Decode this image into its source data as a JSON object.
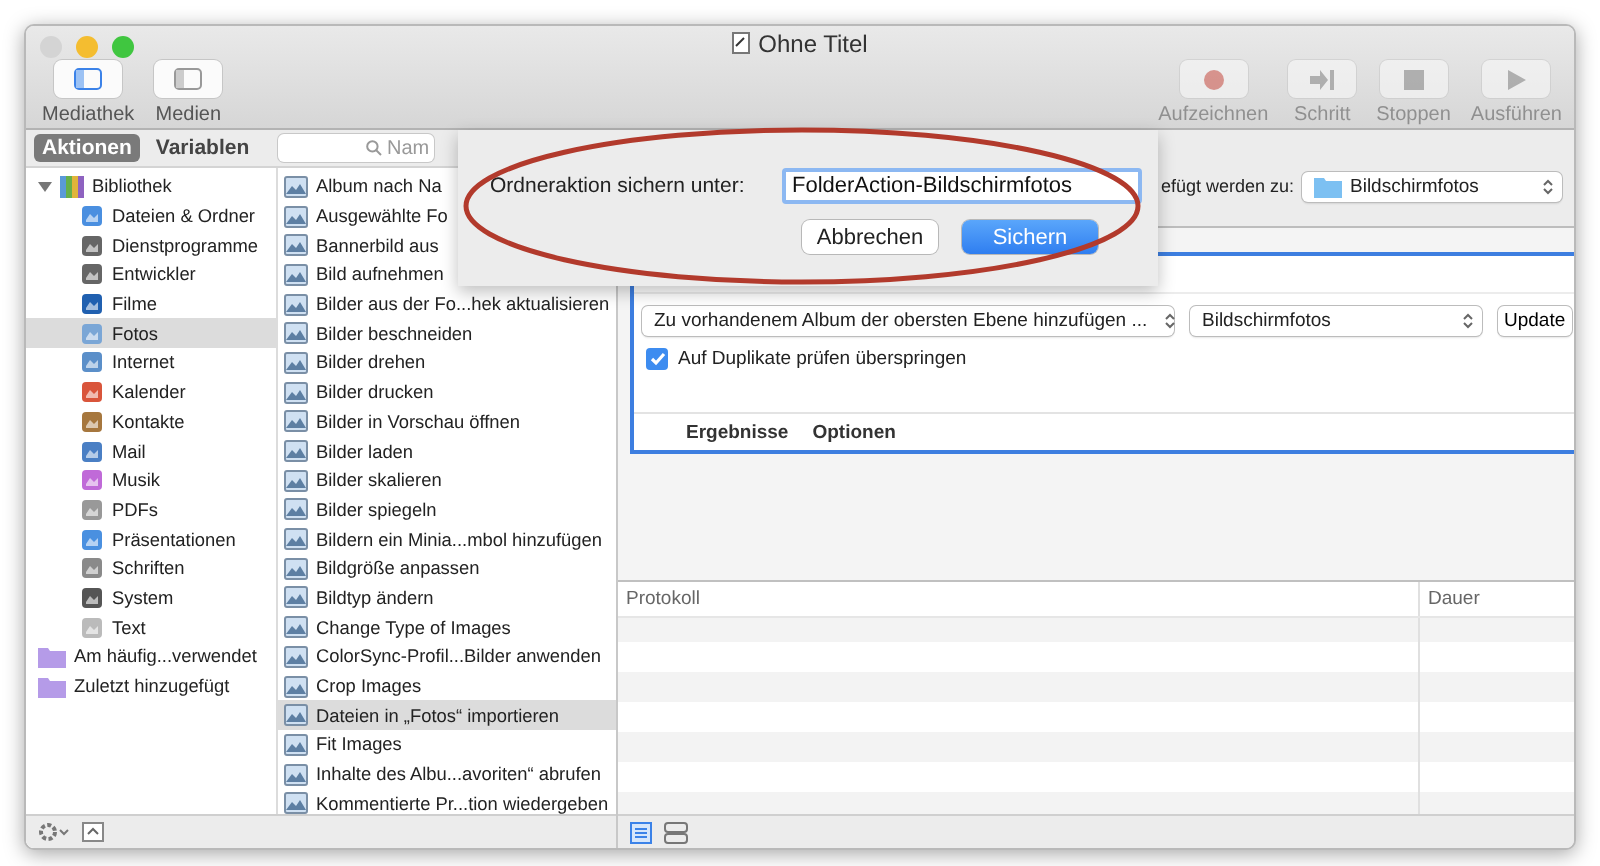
{
  "window": {
    "title": "Ohne Titel"
  },
  "toolbar_left": [
    {
      "label": "Mediathek",
      "selected": true
    },
    {
      "label": "Medien",
      "selected": false
    }
  ],
  "toolbar_right": [
    {
      "label": "Aufzeichnen",
      "kind": "record",
      "disabled": true
    },
    {
      "label": "Schritt",
      "kind": "step",
      "disabled": true
    },
    {
      "label": "Stoppen",
      "kind": "stop",
      "disabled": true
    },
    {
      "label": "Ausführen",
      "kind": "run",
      "disabled": true
    }
  ],
  "tabs": [
    {
      "label": "Aktionen",
      "selected": true
    },
    {
      "label": "Variablen",
      "selected": false
    }
  ],
  "search": {
    "placeholder": "Nam"
  },
  "library": {
    "label": "Bibliothek",
    "expanded": true,
    "children": [
      {
        "label": "Dateien & Ordner",
        "selected": false
      },
      {
        "label": "Dienstprogramme",
        "selected": false
      },
      {
        "label": "Entwickler",
        "selected": false
      },
      {
        "label": "Filme",
        "selected": false
      },
      {
        "label": "Fotos",
        "selected": true
      },
      {
        "label": "Internet",
        "selected": false
      },
      {
        "label": "Kalender",
        "selected": false
      },
      {
        "label": "Kontakte",
        "selected": false
      },
      {
        "label": "Mail",
        "selected": false
      },
      {
        "label": "Musik",
        "selected": false
      },
      {
        "label": "PDFs",
        "selected": false
      },
      {
        "label": "Präsentationen",
        "selected": false
      },
      {
        "label": "Schriften",
        "selected": false
      },
      {
        "label": "System",
        "selected": false
      },
      {
        "label": "Text",
        "selected": false
      }
    ]
  },
  "smart_folders": [
    {
      "label": "Am häufig...verwendet",
      "selected": false
    },
    {
      "label": "Zuletzt hinzugefügt",
      "selected": false
    }
  ],
  "actions": [
    {
      "label": "Album nach Na",
      "selected": false
    },
    {
      "label": "Ausgewählte Fo",
      "selected": false
    },
    {
      "label": "Bannerbild aus",
      "selected": false
    },
    {
      "label": "Bild aufnehmen",
      "selected": false
    },
    {
      "label": "Bilder aus der Fo...hek aktualisieren",
      "selected": false
    },
    {
      "label": "Bilder beschneiden",
      "selected": false
    },
    {
      "label": "Bilder drehen",
      "selected": false
    },
    {
      "label": "Bilder drucken",
      "selected": false
    },
    {
      "label": "Bilder in Vorschau öffnen",
      "selected": false
    },
    {
      "label": "Bilder laden",
      "selected": false
    },
    {
      "label": "Bilder skalieren",
      "selected": false
    },
    {
      "label": "Bilder spiegeln",
      "selected": false
    },
    {
      "label": "Bildern ein Minia...mbol hinzufügen",
      "selected": false
    },
    {
      "label": "Bildgröße anpassen",
      "selected": false
    },
    {
      "label": "Bildtyp ändern",
      "selected": false
    },
    {
      "label": "Change Type of Images",
      "selected": false
    },
    {
      "label": "ColorSync-Profil...Bilder anwenden",
      "selected": false
    },
    {
      "label": "Crop Images",
      "selected": false
    },
    {
      "label": "Dateien in „Fotos“ importieren",
      "selected": true
    },
    {
      "label": "Fit Images",
      "selected": false
    },
    {
      "label": "Inhalte des Albu...avoriten“ abrufen",
      "selected": false
    },
    {
      "label": "Kommentierte Pr...tion wiedergeben",
      "selected": false
    }
  ],
  "workflow": {
    "header_label": "efügt werden zu:",
    "header_popup": "Bildschirmfotos",
    "card": {
      "popup_1": "Zu vorhandenem Album der obersten Ebene hinzufügen ...",
      "popup_2": "Bildschirmfotos",
      "button": "Update",
      "checkbox": {
        "label": "Auf Duplikate prüfen überspringen",
        "checked": true
      },
      "footer_tabs": [
        "Ergebnisse",
        "Optionen"
      ]
    }
  },
  "log": {
    "columns": [
      "Protokoll",
      "Dauer"
    ]
  },
  "view_buttons": [
    {
      "selected": true
    },
    {
      "selected": false
    }
  ],
  "sheet": {
    "label": "Ordneraktion sichern unter:",
    "value": "FolderAction-Bildschirmfotos",
    "buttons": [
      {
        "label": "Abbrechen",
        "default": false
      },
      {
        "label": "Sichern",
        "default": true
      }
    ]
  }
}
